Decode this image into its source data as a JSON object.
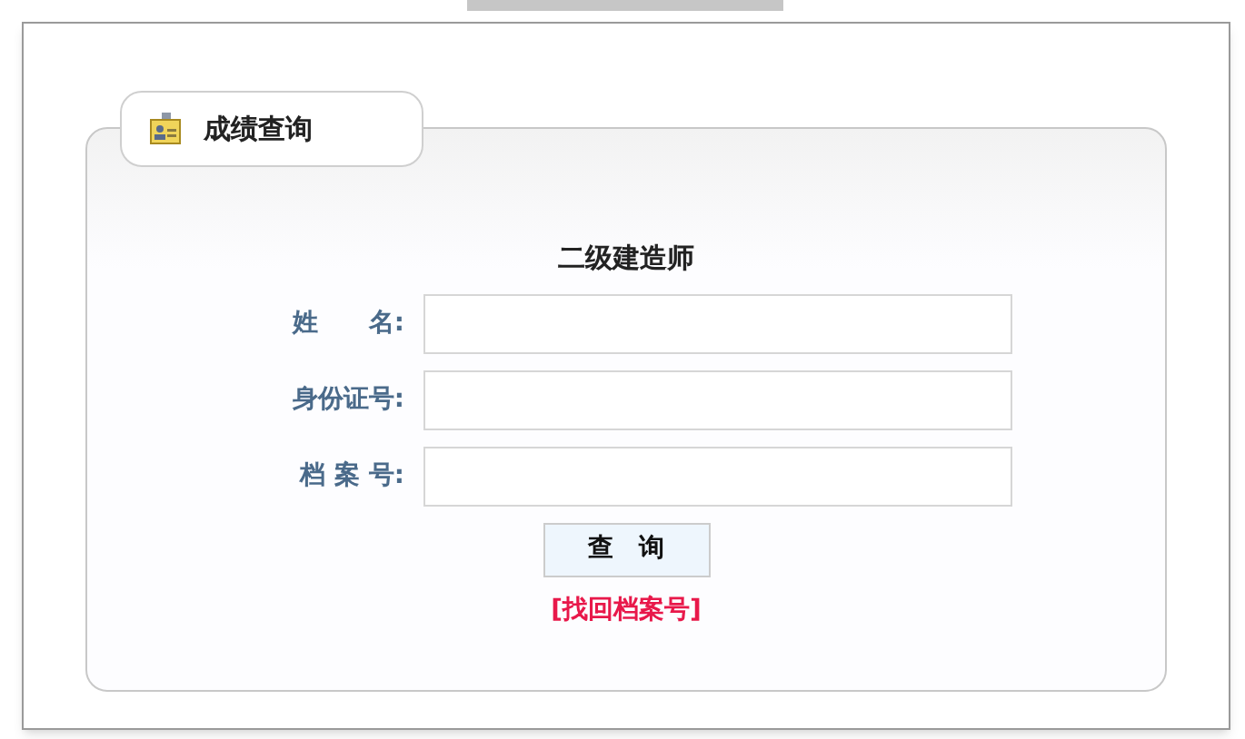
{
  "tab": {
    "title": "成绩查询"
  },
  "form": {
    "heading": "二级建造师",
    "fields": [
      {
        "label": "姓　　名:"
      },
      {
        "label": "身份证号:"
      },
      {
        "label": "档 案 号:"
      }
    ],
    "submit": "查　询",
    "link": "[找回档案号]"
  }
}
